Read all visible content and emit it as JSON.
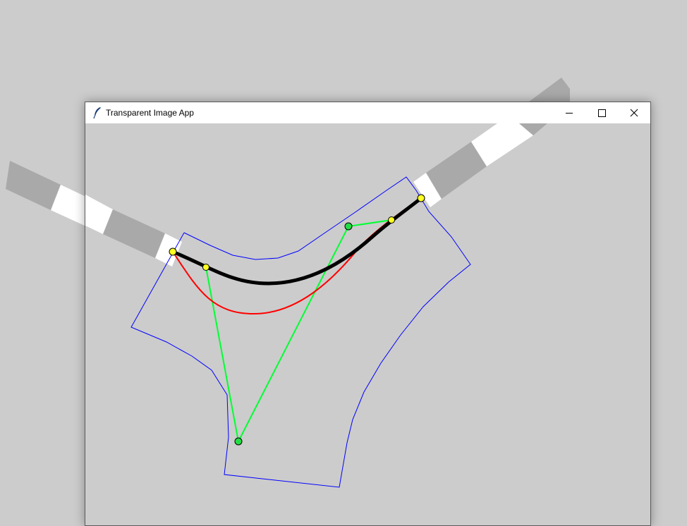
{
  "window": {
    "title": "Transparent Image App",
    "controls": [
      "minimize-icon",
      "maximize-icon",
      "close-icon"
    ]
  },
  "colors": {
    "desktop": "#cccccc",
    "road_dark": "#a9a9a9",
    "road_light": "#ffffff",
    "polygon_outline": "#0000ff",
    "control_polygon": "#00ff33",
    "curve_red": "#ff0000",
    "curve_black": "#000000",
    "control_point_green": "#22dd44",
    "control_point_yellow": "#ffff22"
  },
  "icons": {
    "app_icon": "feather-icon"
  }
}
